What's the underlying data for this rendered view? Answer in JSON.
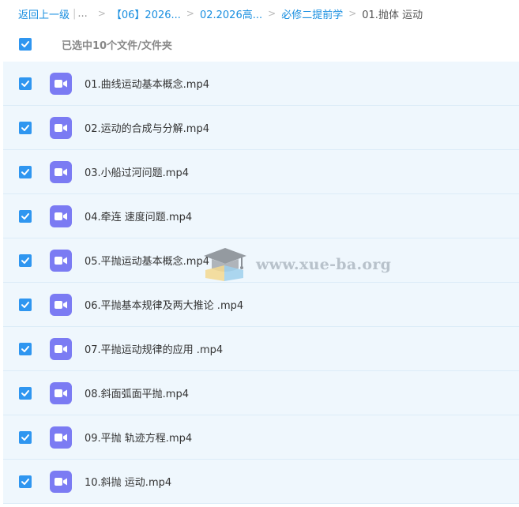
{
  "breadcrumb": {
    "back": "返回上一级",
    "separator": "|",
    "ellipsis": "...",
    "arrow": ">",
    "crumbs": [
      "【06】2026...",
      "02.2026高...",
      "必修二提前学"
    ],
    "current": "01.抛体 运动"
  },
  "selection": {
    "label": "已选中10个文件/文件夹",
    "checked": true
  },
  "files": [
    {
      "name": "01.曲线运动基本概念.mp4",
      "checked": true
    },
    {
      "name": "02.运动的合成与分解.mp4",
      "checked": true
    },
    {
      "name": "03.小船过河问题.mp4",
      "checked": true
    },
    {
      "name": "04.牵连 速度问题.mp4",
      "checked": true
    },
    {
      "name": "05.平抛运动基本概念.mp4",
      "checked": true
    },
    {
      "name": "06.平抛基本规律及两大推论 .mp4",
      "checked": true
    },
    {
      "name": "07.平抛运动规律的应用 .mp4",
      "checked": true
    },
    {
      "name": "08.斜面弧面平抛.mp4",
      "checked": true
    },
    {
      "name": "09.平抛 轨迹方程.mp4",
      "checked": true
    },
    {
      "name": "10.斜抛 运动.mp4",
      "checked": true
    }
  ],
  "watermark": {
    "text": "www.xue-ba.org",
    "icon": "graduation-cap-icon"
  },
  "colors": {
    "link": "#1a8fe0",
    "checkbox": "#2f96f0",
    "row_bg": "#eff7fd",
    "file_icon": "#7b7bf3"
  }
}
